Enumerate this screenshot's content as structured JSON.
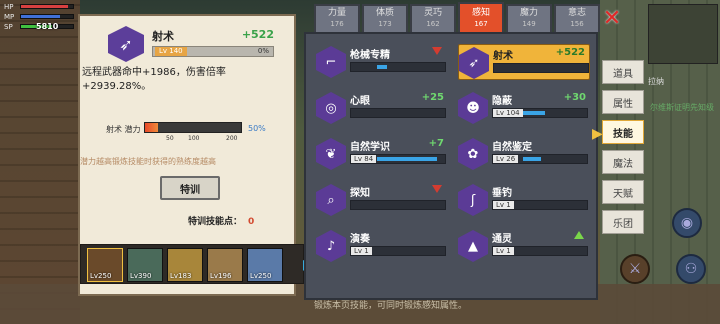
{
  "hud": {
    "hp_tag": "HP",
    "mp_tag": "MP",
    "sp_tag": "SP",
    "value": "5810"
  },
  "selected_skill": {
    "name": "射术",
    "bonus": "+522",
    "lv_tag": "Lv 140",
    "progress": "0%",
    "description": "远程武器命中+1986，伤害倍率+2939.28%。",
    "potential_label": "射术 潜力",
    "potential_ticks": [
      "50",
      "100",
      "200"
    ],
    "potential_pct": "50%",
    "potential_note": "潜力越高锻炼技能时获得的熟练度越高",
    "train_button": "特训",
    "train_points_label": "特训技能点：",
    "train_points_value": "0"
  },
  "tabs": [
    {
      "label": "力量",
      "num": "176"
    },
    {
      "label": "体质",
      "num": "173"
    },
    {
      "label": "灵巧",
      "num": "162"
    },
    {
      "label": "感知",
      "num": "167"
    },
    {
      "label": "魔力",
      "num": "149"
    },
    {
      "label": "意志",
      "num": "156"
    }
  ],
  "skills": [
    {
      "name": "枪械专精",
      "bonus": "",
      "lv": "",
      "trend": "down",
      "icon": "gun-icon"
    },
    {
      "name": "射术",
      "bonus": "+522",
      "lv": "",
      "trend": "",
      "icon": "arrow-icon"
    },
    {
      "name": "心眼",
      "bonus": "+25",
      "lv": "",
      "trend": "",
      "icon": "eye-icon"
    },
    {
      "name": "隐蔽",
      "bonus": "+30",
      "lv": "Lv 104",
      "trend": "",
      "icon": "hide-icon"
    },
    {
      "name": "自然学识",
      "bonus": "+7",
      "lv": "Lv 84",
      "trend": "",
      "icon": "leaf-icon"
    },
    {
      "name": "自然鉴定",
      "bonus": "",
      "lv": "Lv 26",
      "trend": "",
      "icon": "nature-icon"
    },
    {
      "name": "探知",
      "bonus": "",
      "lv": "",
      "trend": "down",
      "icon": "magnify-icon"
    },
    {
      "name": "垂钓",
      "bonus": "",
      "lv": "Lv 1",
      "trend": "",
      "icon": "fishing-icon"
    },
    {
      "name": "演奏",
      "bonus": "",
      "lv": "Lv 1",
      "trend": "",
      "icon": "music-icon"
    },
    {
      "name": "通灵",
      "bonus": "",
      "lv": "Lv 1",
      "trend": "up",
      "icon": "triforce-icon"
    }
  ],
  "menu": [
    "道具",
    "属性",
    "技能",
    "魔法",
    "天赋",
    "乐团"
  ],
  "heroes": [
    "Lv250",
    "Lv390",
    "Lv183",
    "Lv196",
    "Lv250"
  ],
  "bottom_hint": "锻炼本页技能，可同时锻炼感知属性。",
  "right_note": "尔维斯证明先知级",
  "right_note2": "拉纳"
}
